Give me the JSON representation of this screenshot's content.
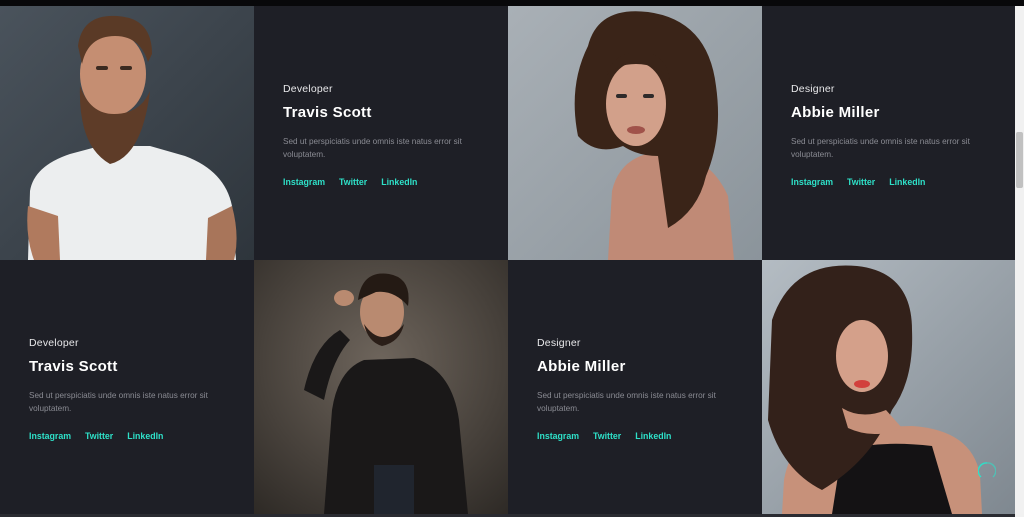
{
  "team": [
    {
      "role": "Developer",
      "name": "Travis Scott",
      "description": "Sed ut perspiciatis unde omnis iste natus error sit voluptatem.",
      "links": [
        "Instagram",
        "Twitter",
        "LinkedIn"
      ]
    },
    {
      "role": "Designer",
      "name": "Abbie Miller",
      "description": "Sed ut perspiciatis unde omnis iste natus error sit voluptatem.",
      "links": [
        "Instagram",
        "Twitter",
        "LinkedIn"
      ]
    },
    {
      "role": "Developer",
      "name": "Travis Scott",
      "description": "Sed ut perspiciatis unde omnis iste natus error sit voluptatem.",
      "links": [
        "Instagram",
        "Twitter",
        "LinkedIn"
      ]
    },
    {
      "role": "Designer",
      "name": "Abbie Miller",
      "description": "Sed ut perspiciatis unde omnis iste natus error sit voluptatem.",
      "links": [
        "Instagram",
        "Twitter",
        "LinkedIn"
      ]
    }
  ],
  "colors": {
    "background": "#1e1f26",
    "accent": "#2ee0c8",
    "name": "#ffffff",
    "text": "#8a8b93"
  },
  "icons": {
    "scroll_top": "arrow-up-circle-icon"
  }
}
